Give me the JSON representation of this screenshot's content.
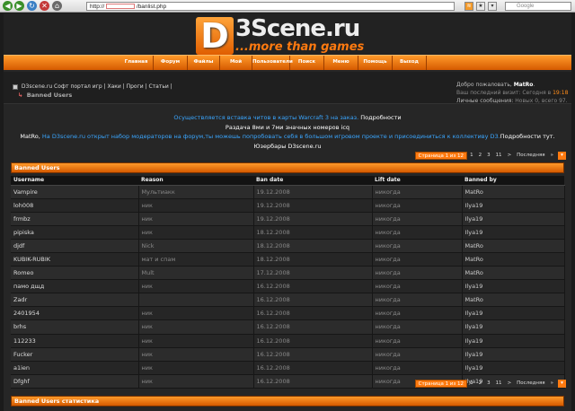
{
  "browser": {
    "url_prefix": "http://",
    "url_suffix": "/banlist.php",
    "search_placeholder": "Google"
  },
  "logo": {
    "letter": "D",
    "name": "3Scene.ru",
    "tagline": "...more than games"
  },
  "menu": {
    "items": [
      "Главная",
      "Форум",
      "Файлы",
      "Мой кабинет",
      "Пользователи",
      "Поиск",
      "Меню",
      "Помощь",
      "Выход"
    ]
  },
  "breadcrumb": {
    "path": "D3scene.ru Софт портал игр | Хаки | Проги | Статьи |",
    "current": "Banned Users"
  },
  "welcome": {
    "greeting": "Добро пожаловать,",
    "user": "MatRo",
    "last_visit_label": "Ваш последний визит: Сегодня в",
    "last_visit_time": "19:18",
    "messages_label": "Личные сообщения:",
    "messages_value": "Новых 0, всего 97."
  },
  "announcement": {
    "line1_blue": "Осуществляется вставка читов в карты Warcraft 3 на заказ.",
    "line1_white": "Подробности",
    "line2": "Раздача 8ми и 7ми значных номеров icq",
    "line3_user": "MatRo,",
    "line3_blue": "На D3scene.ru открыт набор модераторов на форум,ты можешь попробовать себя в большом игровом проекте и присоединиться к коллективу D3.",
    "line3_white": "Подробности тут.",
    "line4": "Юзербары D3scene.ru"
  },
  "pager": {
    "current_label": "Страница 1 из 12",
    "pages": [
      "1",
      "2",
      "3",
      "11"
    ],
    "next": ">",
    "last": "Последняя"
  },
  "banned_panel": {
    "title": "Banned Users",
    "columns": [
      "Username",
      "Reason",
      "Ban date",
      "Lift date",
      "Banned by"
    ],
    "rows": [
      {
        "user": "Vampire",
        "reason": "Мультиакк",
        "ban": "19.12.2008",
        "lift": "никогда",
        "by": "MatRo"
      },
      {
        "user": "loh008",
        "reason": "ник",
        "ban": "19.12.2008",
        "lift": "никогда",
        "by": "Ilya19"
      },
      {
        "user": "frmbz",
        "reason": "ник",
        "ban": "19.12.2008",
        "lift": "никогда",
        "by": "Ilya19"
      },
      {
        "user": "pipiska",
        "reason": "ник",
        "ban": "18.12.2008",
        "lift": "никогда",
        "by": "Ilya19"
      },
      {
        "user": "djdf",
        "reason": "Nick",
        "ban": "18.12.2008",
        "lift": "никогда",
        "by": "MatRo"
      },
      {
        "user": "KUBIK-RUBIK",
        "reason": "мат и спам",
        "ban": "18.12.2008",
        "lift": "никогда",
        "by": "MatRo"
      },
      {
        "user": "Romeo",
        "reason": "Mult",
        "ban": "17.12.2008",
        "lift": "никогда",
        "by": "MatRo"
      },
      {
        "user": "памо дщд",
        "reason": "ник",
        "ban": "16.12.2008",
        "lift": "никогда",
        "by": "Ilya19"
      },
      {
        "user": "Zadr",
        "reason": "",
        "ban": "16.12.2008",
        "lift": "никогда",
        "by": "MatRo"
      },
      {
        "user": "2401954",
        "reason": "ник",
        "ban": "16.12.2008",
        "lift": "никогда",
        "by": "Ilya19"
      },
      {
        "user": "brhs",
        "reason": "ник",
        "ban": "16.12.2008",
        "lift": "никогда",
        "by": "Ilya19"
      },
      {
        "user": "112233",
        "reason": "ник",
        "ban": "16.12.2008",
        "lift": "никогда",
        "by": "Ilya19"
      },
      {
        "user": "Fucker",
        "reason": "ник",
        "ban": "16.12.2008",
        "lift": "никогда",
        "by": "Ilya19"
      },
      {
        "user": "a1ien",
        "reason": "ник",
        "ban": "16.12.2008",
        "lift": "никогда",
        "by": "Ilya19"
      },
      {
        "user": "Dfghf",
        "reason": "ник",
        "ban": "16.12.2008",
        "lift": "никогда",
        "by": "Ilya19"
      }
    ]
  },
  "stats_panel": {
    "title": "Banned Users статистика"
  },
  "colors": {
    "accent": "#ff7a10",
    "link_blue": "#3aa6ff",
    "background": "#262626"
  }
}
